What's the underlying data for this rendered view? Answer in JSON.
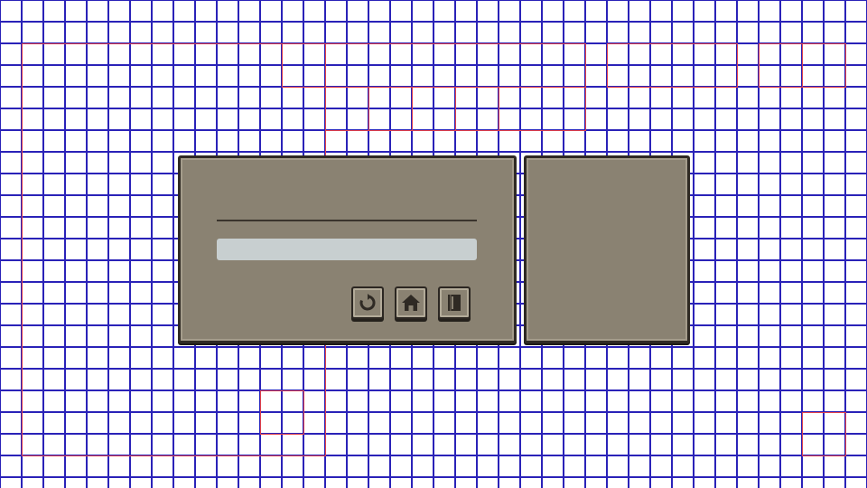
{
  "scene": {
    "description_free": true
  },
  "dialog": {
    "progress": 0,
    "buttons": [
      {
        "icon": "restart-icon"
      },
      {
        "icon": "home-icon"
      },
      {
        "icon": "book-icon"
      }
    ]
  },
  "colors": {
    "grid_line": "#2a22b8",
    "debug_outline": "#e0404a",
    "panel_fill": "#8a8272",
    "panel_border": "#2f2a24",
    "bar_fill": "#c8cfd0",
    "icon": "#2f2a24"
  }
}
